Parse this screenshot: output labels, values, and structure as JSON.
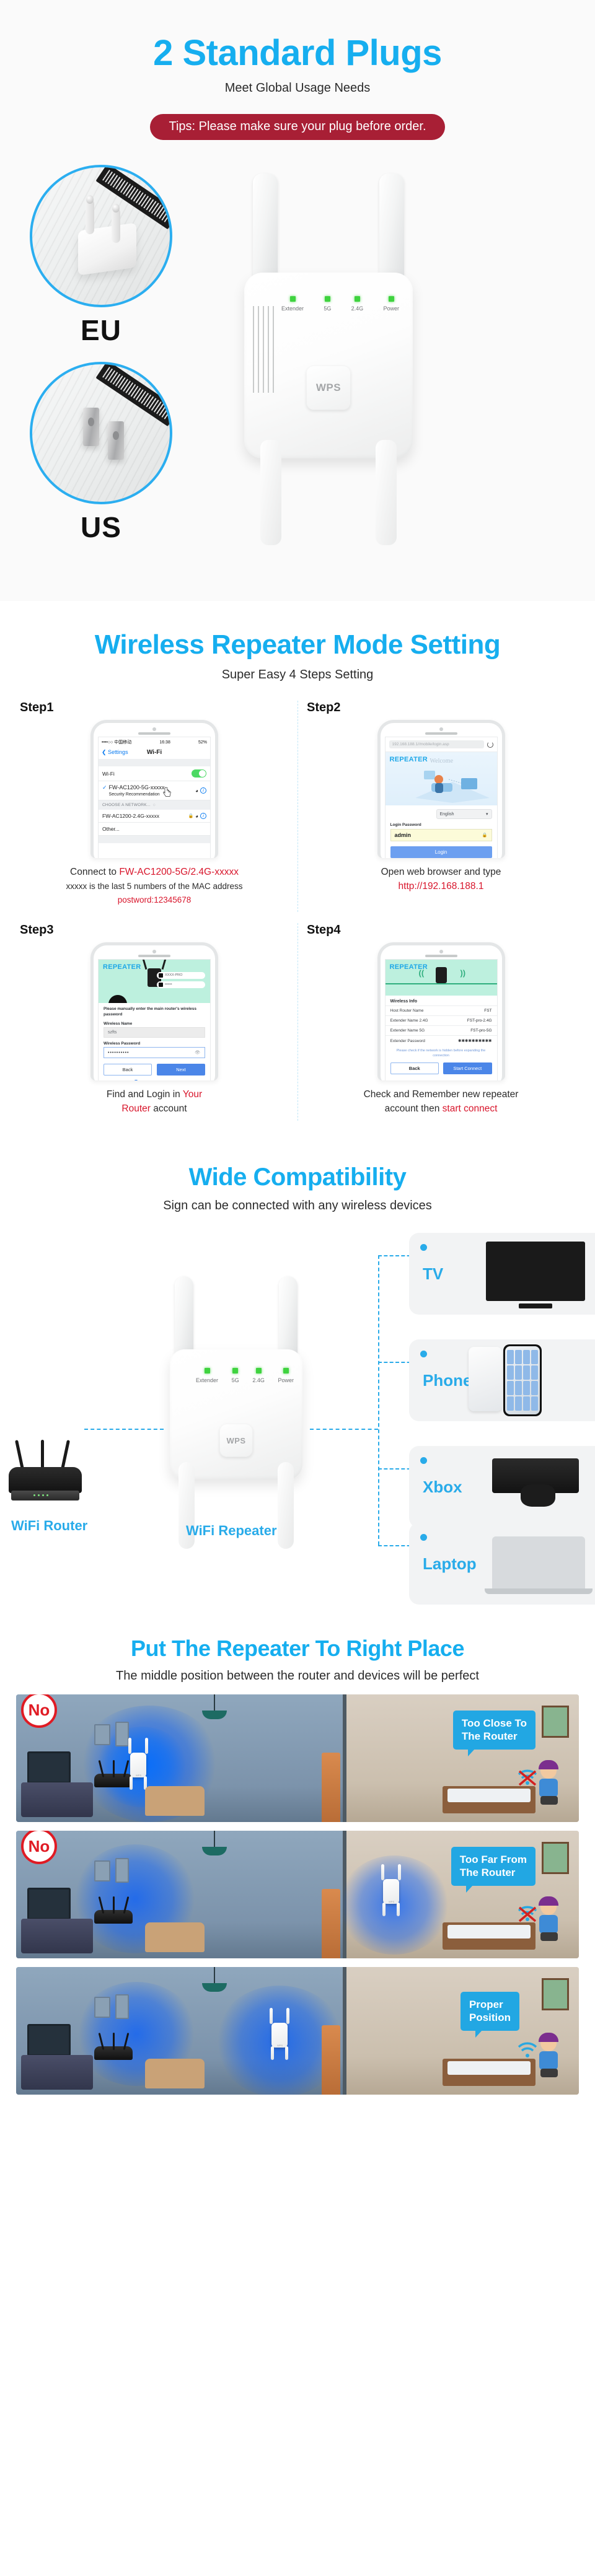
{
  "plugs_section": {
    "title": "2 Standard Plugs",
    "subtitle": "Meet Global Usage Needs",
    "tips": "Tips: Please make sure your plug before order.",
    "plug_eu_label": "EU",
    "plug_us_label": "US",
    "device_leds": [
      "Extender",
      "5G",
      "2.4G",
      "Power"
    ],
    "wps_label": "WPS",
    "accent_color": "#16AEEF",
    "tips_color": "#A81F35",
    "led_color": "#3FD33F"
  },
  "steps_section": {
    "title": "Wireless Repeater Mode Setting",
    "subtitle": "Super Easy 4 Steps Setting",
    "steps": [
      {
        "label": "Step1",
        "caption_line1_plain": "Connect to ",
        "caption_line1_hl": "FW-AC1200-5G/2.4G-xxxxx",
        "caption_line2": "xxxxx is the last 5 numbers of the MAC address",
        "caption_line3_hl": "postword:12345678",
        "phone": {
          "status_carrier": "••••○○ 中国移动",
          "status_time": "16:38",
          "status_battery": "52%",
          "nav_back": "Settings",
          "nav_title": "Wi-Fi",
          "row_wifi_label": "Wi-Fi",
          "connected_ssid": "FW-AC1200-5G-xxxxx",
          "connected_sub": "Security Recommendation",
          "section_header": "CHOOSE A NETWORK...",
          "networks": [
            "FW-AC1200-2.4G-xxxxx",
            "Other..."
          ]
        }
      },
      {
        "label": "Step2",
        "caption_line1": "Open web browser and type",
        "caption_line2_hl": "http://192.168.188.1",
        "phone": {
          "url": "192.168.188.1//mobile/login.asp",
          "brand": "REPEATER",
          "welcome": "Welcome",
          "language": "English",
          "password_label": "Login Password",
          "password_value": "admin",
          "login_button": "Login"
        }
      },
      {
        "label": "Step3",
        "caption_line1_plain": "Find and Login in ",
        "caption_line1_hl": "Your",
        "caption_line2_hl": "Router",
        "caption_line2_plain": " account",
        "phone": {
          "brand": "REPEATER",
          "cred_user": "XXXX-PRO",
          "cred_pass": "••••••",
          "note": "Please manually enter the main router's wireless password",
          "name_label": "Wireless Name",
          "name_value": "szfts",
          "password_label": "Wireless Password",
          "password_value": "••••••••••",
          "back_button": "Back",
          "next_button": "Next"
        }
      },
      {
        "label": "Step4",
        "caption_line1": "Check and Remember new repeater",
        "caption_line2_plain": "account then ",
        "caption_line2_hl": "start connect",
        "phone": {
          "brand": "REPEATER",
          "info_title": "Wireless Info",
          "rows": [
            {
              "label": "Host Router Name",
              "value": "FST"
            },
            {
              "label": "Extender Name 2.4G",
              "value": "FST-pro-2.4G"
            },
            {
              "label": "Extender Name 5G",
              "value": "FST-pro-5G"
            },
            {
              "label": "Extender Password",
              "value": "✱✱✱✱✱✱✱✱✱✱"
            }
          ],
          "hint": "Please check if the network is hidden before expanding the connection",
          "back_button": "Back",
          "start_button": "Start Connect"
        }
      }
    ]
  },
  "compat_section": {
    "title": "Wide Compatibility",
    "subtitle": "Sign can be connected with any wireless devices",
    "router_label": "WiFi Router",
    "repeater_label": "WiFi Repeater",
    "device_leds": [
      "Extender",
      "5G",
      "2.4G",
      "Power"
    ],
    "wps_label": "WPS",
    "devices": [
      "TV",
      "Phone",
      "Xbox",
      "Laptop"
    ]
  },
  "place_section": {
    "title": "Put The Repeater To Right Place",
    "subtitle": "The middle position between the router and devices will be perfect",
    "panels": [
      {
        "badge": "No",
        "callout": "Too Close To\nThe Router",
        "status": "bad"
      },
      {
        "badge": "No",
        "callout": "Too Far From\nThe Router",
        "status": "bad"
      },
      {
        "badge": "",
        "callout": "Proper\nPosition",
        "status": "good"
      }
    ]
  }
}
